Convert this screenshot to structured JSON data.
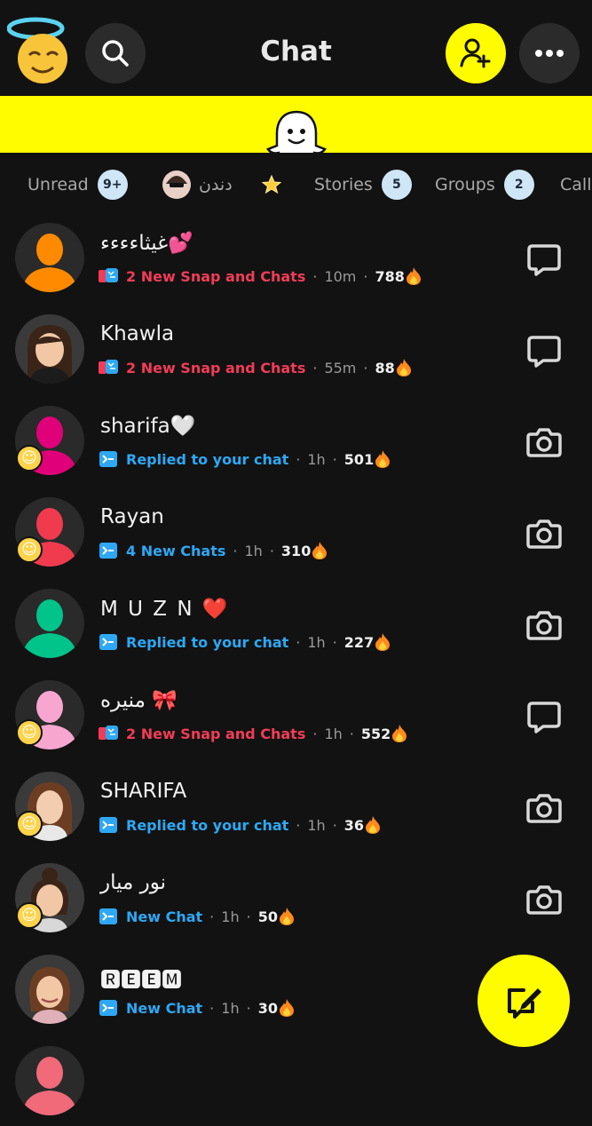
{
  "header": {
    "title": "Chat"
  },
  "icons": [
    "avatar-halo",
    "search-icon",
    "add-friend-icon",
    "more-icon",
    "ghost-logo",
    "chat-bubble-icon",
    "camera-icon",
    "new-chat-icon",
    "fire-icon"
  ],
  "colors": {
    "brand_yellow": "#fffc00",
    "background": "#121212",
    "red": "#f23c57",
    "blue": "#2ea8f5"
  },
  "filters": {
    "unread": {
      "label": "Unread",
      "count": "9+"
    },
    "favorite": {
      "label": "دندن"
    },
    "stories": {
      "label": "Stories",
      "count": "5"
    },
    "groups": {
      "label": "Groups",
      "count": "2"
    },
    "calls": {
      "label": "Call"
    }
  },
  "chats": [
    {
      "name": "غيثاءءءء💕",
      "status": "2 New Snap and Chats",
      "time": "10m",
      "streak": "788"
    },
    {
      "name": "Khawla",
      "status": "2 New Snap and Chats",
      "time": "55m",
      "streak": "88"
    },
    {
      "name": "sharifa🤍",
      "status": "Replied to your chat",
      "time": "1h",
      "streak": "501"
    },
    {
      "name": "Rayan",
      "status": "4 New Chats",
      "time": "1h",
      "streak": "310"
    },
    {
      "name": "M U Z N ❤️",
      "status": "Replied to your chat",
      "time": "1h",
      "streak": "227"
    },
    {
      "name": "منيره 🎀",
      "status": "2 New Snap and Chats",
      "time": "1h",
      "streak": "552"
    },
    {
      "name": "SHARIFA",
      "status": "Replied to your chat",
      "time": "1h",
      "streak": "36"
    },
    {
      "name": "نور ميار",
      "status": "New Chat",
      "time": "1h",
      "streak": "50"
    },
    {
      "name": "🆁🅴🅴🅼",
      "status": "New Chat",
      "time": "1h",
      "streak": "30"
    }
  ]
}
